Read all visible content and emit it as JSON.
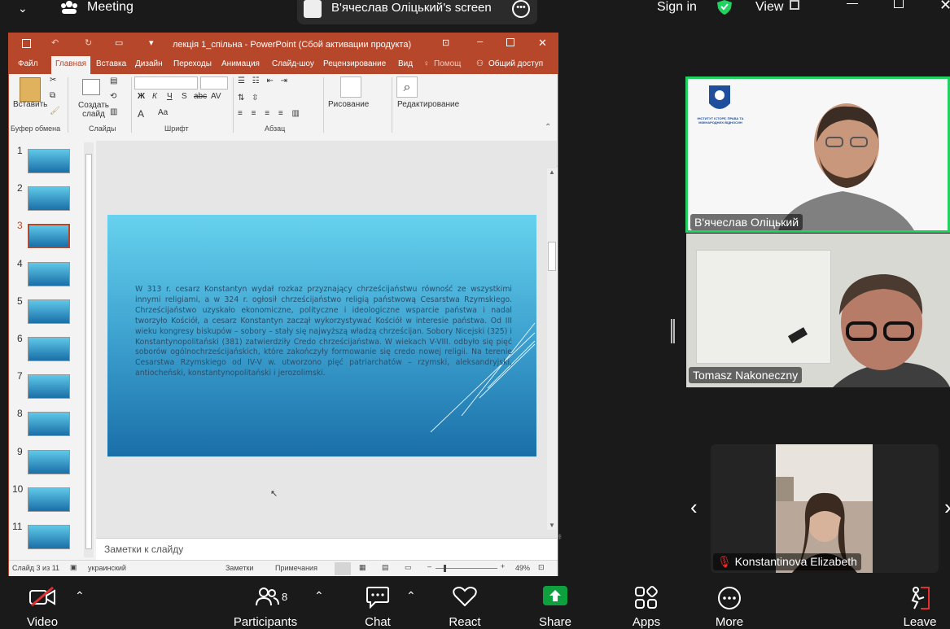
{
  "zoom_top": {
    "meeting_label": "Meeting",
    "screen_owner": "В'ячеслав Оліцький's screen",
    "sign_in": "Sign in",
    "view": "View"
  },
  "ppt": {
    "title": "лекція 1_спільна - PowerPoint (Сбой активации продукта)",
    "tabs": [
      "Файл",
      "Главная",
      "Вставка",
      "Дизайн",
      "Переходы",
      "Анимация",
      "Слайд-шоу",
      "Рецензирование",
      "Вид",
      "Помощ",
      "Общий доступ"
    ],
    "ribbon": {
      "paste": "Вставить",
      "new_slide": "Создать слайд",
      "drawing": "Рисование",
      "editing": "Редактирование",
      "groups": [
        "Буфер обмена",
        "Слайды",
        "Шрифт",
        "Абзац"
      ],
      "font_buttons": [
        "Ж",
        "К",
        "Ч",
        "S",
        "abc",
        "AV",
        "A",
        "Aa"
      ]
    },
    "slide_numbers": [
      "1",
      "2",
      "3",
      "4",
      "5",
      "6",
      "7",
      "8",
      "9",
      "10",
      "11"
    ],
    "slide_text": "W 313 r. cesarz Konstantyn wydał rozkaz przyznający chrześcijaństwu równość ze wszystkimi innymi religiami, a w 324 r. ogłosił chrześcijaństwo religią państwową Cesarstwa Rzymskiego. Chrześcijaństwo uzyskało ekonomiczne, polityczne i ideologiczne wsparcie państwa i nadal tworzyło Kościół, a cesarz Konstantyn zaczął wykorzystywać Kościół w interesie państwa. Od III wieku kongresy biskupów – sobory – stały się najwyższą władzą chrześcijan. Sobory Nicejski (325) i Konstantynopolitański (381) zatwierdziły Credo chrześcijaństwa. W wiekach V-VIII. odbyło się pięć soborów ogólnochrześcijańskich, które zakończyły formowanie się credo nowej religii. Na terenie Cesarstwa Rzymskiego od IV-V w. utworzono pięć patriarchatów – rzymski, aleksandryjski, antiocheński, konstantynopolitański i jerozolimski.",
    "notes_placeholder": "Заметки к слайду",
    "status": {
      "slide_of": "Слайд 3 из 11",
      "language": "украинский",
      "notes": "Заметки",
      "comments": "Примечания",
      "zoom": "49%"
    }
  },
  "participants_tiles": [
    {
      "name": "В'ячеслав Оліцький",
      "logo_text": "ІНСТИТУТ ІСТОРІЇ, ПРАВА ТА МІЖНАРОДНИХ ВІДНОСИН"
    },
    {
      "name": "Tomasz Nakoneczny"
    },
    {
      "name": "Konstantinova Elizabeth"
    }
  ],
  "bottom_bar": {
    "video": "Video",
    "participants": "Participants",
    "participants_count": "8",
    "chat": "Chat",
    "react": "React",
    "share": "Share",
    "apps": "Apps",
    "more": "More",
    "leave": "Leave"
  },
  "colors": {
    "ppt_accent": "#b7472a",
    "active_speaker_border": "#23d160",
    "share_green": "#0e9f3e",
    "mute_red": "#e03030"
  }
}
